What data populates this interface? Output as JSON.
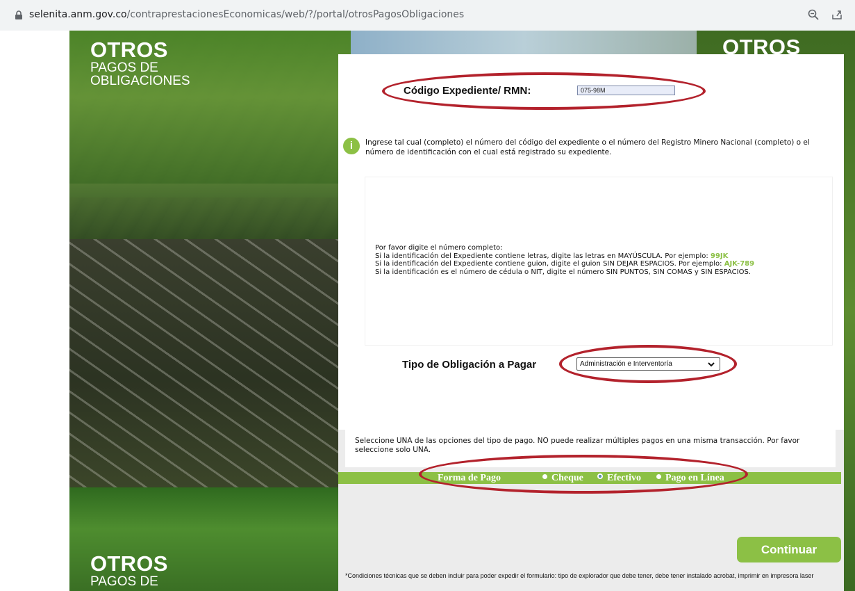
{
  "browser": {
    "url_domain": "selenita.anm.gov.co",
    "url_path": "/contraprestacionesEconomicas/web/?/portal/otrosPagosObligaciones"
  },
  "branding": {
    "title_main": "OTROS",
    "title_line2": "PAGOS DE",
    "title_line3": "OBLIGACIONES",
    "right_title": "OTROS"
  },
  "form": {
    "codigo_label": "Código Expediente/ RMN:",
    "codigo_value": "075-98M",
    "info_icon_glyph": "i",
    "info_text": "Ingrese tal cual (completo) el número del código del expediente o el número del Registro Minero Nacional (completo) o el número de identificación con el cual está registrado su expediente.",
    "instructions": {
      "line1": "Por favor digite el número completo:",
      "line2_prefix": "Si la identificación del Expediente contiene letras, digite las letras en MAYÚSCULA. Por ejemplo: ",
      "line2_example": "99JK",
      "line3_prefix": "Si la identificación del Expediente contiene guion, digite el guion SIN DEJAR ESPACIOS. Por ejemplo: ",
      "line3_example": "AJK-789",
      "line4": "Si la identificación es el número de cédula o NIT, digite el número SIN PUNTOS, SIN COMAS y SIN ESPACIOS."
    },
    "tipo_label": "Tipo de Obligación a Pagar",
    "tipo_selected": "Administración e Interventoría",
    "payment_note": "Seleccione UNA de las opciones del tipo de pago. NO puede realizar múltiples pagos en una misma transacción. Por favor seleccione solo UNA.",
    "forma_pago_label": "Forma de Pago",
    "payment_options": [
      {
        "label": "Cheque",
        "selected": false
      },
      {
        "label": "Efectivo",
        "selected": true
      },
      {
        "label": "Pago en Línea",
        "selected": false
      }
    ],
    "continuar_label": "Continuar",
    "footnote": "*Condiciones técnicas que se deben incluir para poder expedir el formulario: tipo de explorador que debe tener, debe tener instalado acrobat, imprimir en impresora laser"
  },
  "colors": {
    "accent_green": "#8cc045",
    "annotation_red": "#b3222c"
  }
}
